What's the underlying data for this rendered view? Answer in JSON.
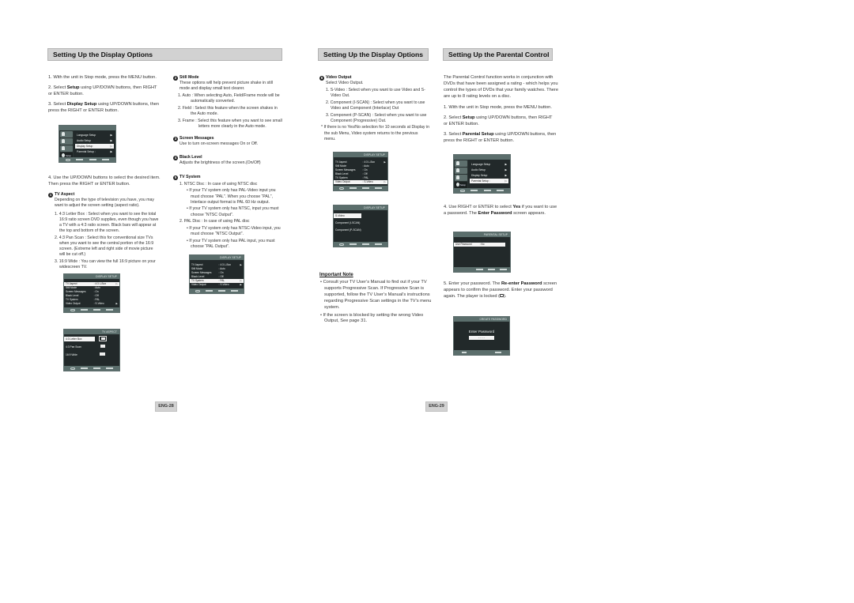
{
  "left_page": {
    "banner": "Setting Up the Display Options",
    "steps": [
      {
        "num": "1.",
        "text": "With the unit in Stop mode, press the MENU button."
      },
      {
        "num": "2.",
        "pre": "Select ",
        "bold": "Setup",
        "post": " using UP/DOWN buttons, then RIGHT or ENTER button."
      },
      {
        "num": "3.",
        "pre": "Select ",
        "bold": "Display Setup",
        "post": " using UP/DOWN buttons, then press the RIGHT or ENTER button."
      },
      {
        "num": "4.",
        "text": "Use the UP/DOWN buttons to select the desired item. Then press the RIGHT or ENTER button."
      }
    ],
    "tv_aspect": {
      "badge": "1",
      "title": "TV Aspect",
      "desc": "Depending on the type of television you have, you may want to adjust the screen setting (aspect ratio).",
      "items": [
        "1. 4:3 Letter Box : Select when you want to see the total 16:9 ratio screen DVD supplies, even though you have a TV with a 4:3 ratio screen. Black bars will appear at the top and bottom of the screen.",
        "2. 4:3 Pan Scan : Select this for conventional size TVs when you want to see the central portion of the 16:9 screen. (Extreme left and right side of movie picture will be cut off.)",
        "3. 16:9 Wide : You can view the full 16:9 picture on your widescreen TV."
      ]
    },
    "still_mode": {
      "badge": "2",
      "title": "Still Mode",
      "desc": "These options will help prevent picture shake in still mode and display small text clearer.",
      "items": [
        "1. Auto : When selecting Auto, Field/Frame mode will be automatically converted.",
        "2. Field : Select this feature when the screen shakes in the Auto mode.",
        "3. Frame : Select this feature when you want to see small letters more clearly in the Auto mode."
      ]
    },
    "screen_messages": {
      "badge": "3",
      "title": "Screen Messages",
      "desc": "Use to turn on-screen messages On or Off."
    },
    "black_level": {
      "badge": "4",
      "title": "Black Level",
      "desc": "Adjusts the brightness of the screen.(On/Off)"
    },
    "tv_system": {
      "badge": "5",
      "title": "TV System",
      "items": [
        {
          "text": "1. NTSC Disc : In case of using NTSC disc",
          "bullets": [
            "If your TV system only has PAL-Video input you must choose “PAL”. When you choose “PAL”, Interlace output format is PAL 60 Hz output.",
            "If your TV system only has NTSC, input you must choose “NTSC Output”."
          ]
        },
        {
          "text": "2. PAL Disc : In case of using PAL disc",
          "bullets": [
            "If your TV system only has NTSC-Video input, you must choose “NTSC Output”.",
            "If your TV system only has PAL input, you must choose “PAL Output”."
          ]
        }
      ]
    },
    "page_number": "ENG-28"
  },
  "right_page": {
    "banner_display": "Setting Up the Display Options",
    "video_output": {
      "badge": "6",
      "title": "Video Output",
      "desc": "Select Video Output.",
      "items": [
        "1. S-Video : Select when you want to use Video and S-Video Out.",
        "2. Component (I-SCAN) : Select when you want to use Video and Component (Interlace) Out",
        "3. Component (P-SCAN) : Select when you want to use Component (Progressive) Out."
      ],
      "note": "* If there is no Yes/No selection for 10 seconds at Display in the sub Menu, Video system returns to the previous menu."
    },
    "important_note": {
      "title": "Important Note",
      "bullets": [
        "Consult your TV User’s Manual to find out if your TV supports Progressive Scan. If Progressive Scan is supported, follow the TV User’s Manual’s instructions regarding Progressive Scan settings in the TV’s menu system.",
        "If the screen is blocked by setting the wrong Video Output, See page 31."
      ]
    },
    "banner_parental": "Setting Up the Parental Control",
    "parental_intro": "The Parental Control function works in conjunction with DVDs that have been assigned a rating - which helps you control the types of DVDs that your family watches. There are up to 8 rating levels on a disc.",
    "steps": [
      {
        "num": "1.",
        "text": "With the unit in Stop mode, press the MENU button."
      },
      {
        "num": "2.",
        "pre": "Select ",
        "bold": "Setup",
        "post": " using UP/DOWN buttons, then RIGHT or ENTER button."
      },
      {
        "num": "3.",
        "pre": "Select ",
        "bold": "Parental Setup",
        "post": " using UP/DOWN buttons, then press the RIGHT or ENTER button."
      },
      {
        "num": "4.",
        "pre": "Use RIGHT or ENTER to select ",
        "bold": "Yes",
        "post": " if you want to use a password. The ",
        "bold2": "Enter Password",
        "post2": " screen appears."
      },
      {
        "num": "5.",
        "pre": "Enter your password. The ",
        "bold": "Re-enter Password",
        "post": " screen appears to confirm the password. Enter your password again. The player is locked (",
        "icon": "lock-icon",
        "post2": ")."
      }
    ],
    "page_number": "ENG-29"
  },
  "screens": {
    "setup_menu": {
      "side_items": [
        "",
        "",
        "",
        "Setup"
      ],
      "items": [
        {
          "label": "Language Setup",
          "arrow": "▶"
        },
        {
          "label": "Audio Setup",
          "arrow": "▶"
        },
        {
          "label": "Display Setup",
          "arrow": "▷"
        },
        {
          "label": "Parental Setup :",
          "arrow": "▶"
        }
      ]
    },
    "setup_menu_parental": {
      "side_items": [
        "",
        "",
        "",
        "Setup"
      ],
      "items": [
        {
          "label": "Language Setup",
          "arrow": "▶"
        },
        {
          "label": "Audio Setup",
          "arrow": "▶"
        },
        {
          "label": "Display Setup",
          "arrow": "▶"
        },
        {
          "label": "Parental Setup :",
          "arrow": "▷"
        }
      ]
    },
    "display_setup": {
      "title": "DISPLAY SETUP",
      "rows": [
        {
          "key": "TV Aspect",
          "value": ": 4:3 L-Box",
          "arrow": "▶"
        },
        {
          "key": "Still Mode",
          "value": ": Auto",
          "arrow": ""
        },
        {
          "key": "Screen Messages",
          "value": ": On",
          "arrow": ""
        },
        {
          "key": "Black Level",
          "value": ": Off",
          "arrow": ""
        },
        {
          "key": "TV System",
          "value": ": PAL",
          "arrow": ""
        },
        {
          "key": "Video Output",
          "value": ": S-Video",
          "arrow": "▶"
        }
      ]
    },
    "tv_aspect": {
      "title": "TV ASPECT",
      "options": [
        "4:3 Letter Box",
        "4:3 Pan Scan",
        "16:9 Wide"
      ]
    },
    "video_output": {
      "title": "DISPLAY SETUP",
      "options": [
        "S-Video",
        "Component (I-SCAN)",
        "Component (P-SCAN)"
      ]
    },
    "parental_setup": {
      "title": "PARENTAL SETUP",
      "row_key": "Use Password",
      "row_value": ": No"
    },
    "create_password": {
      "title": "CREATE PASSWORD",
      "label": "Enter Password",
      "mask": "- - - -"
    }
  }
}
